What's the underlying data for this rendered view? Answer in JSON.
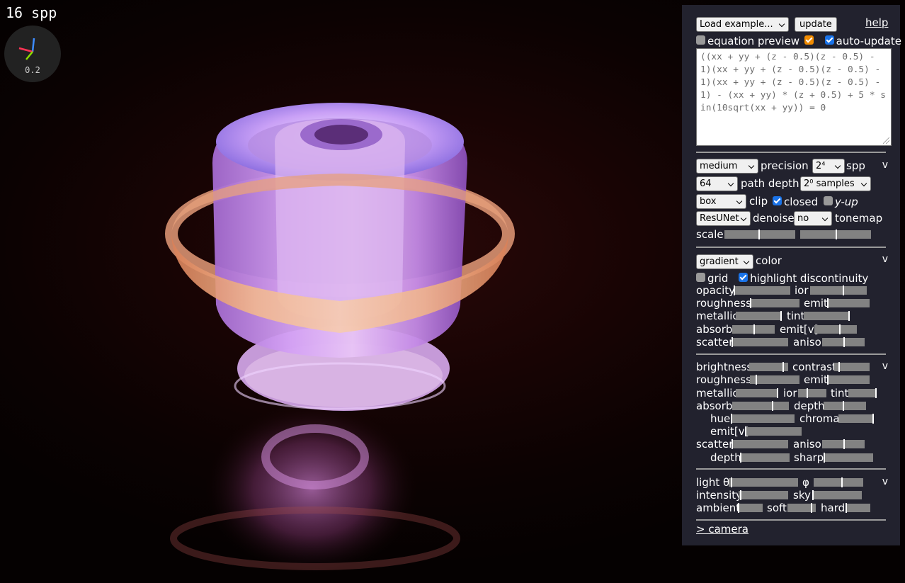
{
  "viewport": {
    "spp_counter": "16 spp",
    "axes_scale": "0.2"
  },
  "panel": {
    "load_example": "Load example...",
    "update_button": "update",
    "help_link": "help",
    "equation_preview_label": "equation preview",
    "auto_update_label": "auto-update",
    "equation_preview_checked": false,
    "auto_update_checked": true,
    "equation": "((xx + yy + (z - 0.5)(z - 0.5) - 1)(xx + yy + (z - 0.5)(z - 0.5) - 1)(xx + yy + (z - 0.5)(z - 0.5) - 1) - (xx + yy) * (z + 0.5) + 5 * sin(10sqrt(xx + yy)) = 0",
    "collapse_symbol": "v",
    "render": {
      "precision_select": "medium",
      "precision_label": "precision",
      "spp_select": "2⁴",
      "spp_label": "spp",
      "depth_select": "64",
      "depth_label": "path depth",
      "samples_select": "2⁰ samples",
      "clip_select": "box",
      "clip_label": "clip",
      "closed_label": "closed",
      "closed_checked": true,
      "yup_label": "y-up",
      "yup_checked": false,
      "denoise_select": "ResUNet",
      "denoise_label": "denoise",
      "tonemap_select": "no",
      "tonemap_label": "tonemap",
      "scale_label": "scale",
      "scale_values": [
        0.48,
        0.5
      ]
    },
    "material": {
      "color_select": "gradient",
      "color_label": "color",
      "grid_label": "grid",
      "grid_checked": false,
      "highlight_label": "highlight discontinuity",
      "highlight_checked": true,
      "opacity_label": "opacity",
      "opacity_value": 0.0,
      "ior_label": "ior",
      "ior_value": 0.57,
      "roughness_label": "roughness",
      "roughness_value": 0.0,
      "emit_label": "emit",
      "emit_value": 0.0,
      "metallic_label": "metallic",
      "metallic_value": 1.0,
      "tint_label": "tint",
      "tint_value": 1.0,
      "absorb_label": "absorb",
      "absorb_value": 0.5,
      "emitv_label": "emit[v]",
      "emitv_value": 0.58,
      "scatter_label": "scatter",
      "scatter_value": 0.0,
      "aniso_label": "aniso",
      "aniso_value": 0.5
    },
    "background": {
      "brightness_label": "brightness",
      "brightness_value": 0.85,
      "contrast_label": "contrast",
      "contrast_value": 0.12,
      "roughness_label": "roughness",
      "roughness_value": 0.12,
      "emit_label": "emit",
      "emit_value": 0.0,
      "metallic_label": "metallic",
      "metallic_value": 0.98,
      "ior_label": "ior",
      "ior_value": 0.3,
      "tint_label": "tint",
      "tint_value": 1.0,
      "absorb_label": "absorb",
      "absorb_value": 0.7,
      "depth_label": "depth",
      "depth_value": 0.45,
      "hue_label": "hue",
      "hue_value": 0.0,
      "chroma_label": "chroma",
      "chroma_value": 0.98,
      "emitv_label": "emit[v]",
      "emitv_value": 0.0,
      "scatter_label": "scatter",
      "scatter_value": 0.0,
      "aniso_label": "aniso",
      "aniso_value": 0.5,
      "depth2_label": "depth",
      "depth2_value": 0.0,
      "sharp_label": "sharp",
      "sharp_value": 0.0
    },
    "lighting": {
      "theta_label": "light θ",
      "theta_value": 0.03,
      "phi_label": "φ",
      "phi_value": 0.55,
      "intensity_label": "intensity",
      "intensity_value": 0.03,
      "sky_label": "sky",
      "sky_value": 0.0,
      "ambient_label": "ambient",
      "ambient_value": 0.0,
      "soft_label": "soft",
      "soft_value": 0.82,
      "hard_label": "hard",
      "hard_value": 0.0
    },
    "camera_link": "> camera"
  },
  "colors": {
    "panel_bg": "#22222e",
    "slider_track": "#828282",
    "checkbox_on": "#1a73e8",
    "checkbox_orange": "#f28c00"
  }
}
